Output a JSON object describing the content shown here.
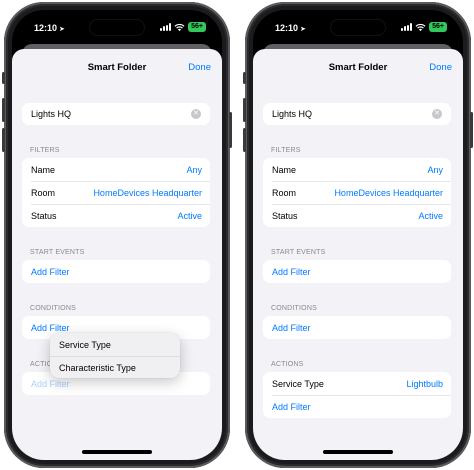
{
  "status": {
    "time": "12:10",
    "battery": "56+"
  },
  "left": {
    "title": "Smart Folder",
    "done": "Done",
    "search_value": "Lights HQ",
    "filters_header": "FILTERS",
    "filters": [
      {
        "label": "Name",
        "value": "Any"
      },
      {
        "label": "Room",
        "value": "HomeDevices Headquarter"
      },
      {
        "label": "Status",
        "value": "Active"
      }
    ],
    "start_events_header": "START EVENTS",
    "start_events_add": "Add Filter",
    "conditions_header": "CONDITIONS",
    "conditions_add": "Add Filter",
    "actions_header": "ACTIONS",
    "actions_add": "Add Filter",
    "menu": [
      "Service Type",
      "Characteristic Type"
    ]
  },
  "right": {
    "title": "Smart Folder",
    "done": "Done",
    "search_value": "Lights HQ",
    "filters_header": "FILTERS",
    "filters": [
      {
        "label": "Name",
        "value": "Any"
      },
      {
        "label": "Room",
        "value": "HomeDevices Headquarter"
      },
      {
        "label": "Status",
        "value": "Active"
      }
    ],
    "start_events_header": "START EVENTS",
    "start_events_add": "Add Filter",
    "conditions_header": "CONDITIONS",
    "conditions_add": "Add Filter",
    "actions_header": "ACTIONS",
    "actions_row": {
      "label": "Service Type",
      "value": "Lightbulb"
    },
    "actions_add": "Add Filter"
  },
  "colors": {
    "accent": "#007aff",
    "background": "#f2f2f7",
    "battery": "#34c759"
  }
}
